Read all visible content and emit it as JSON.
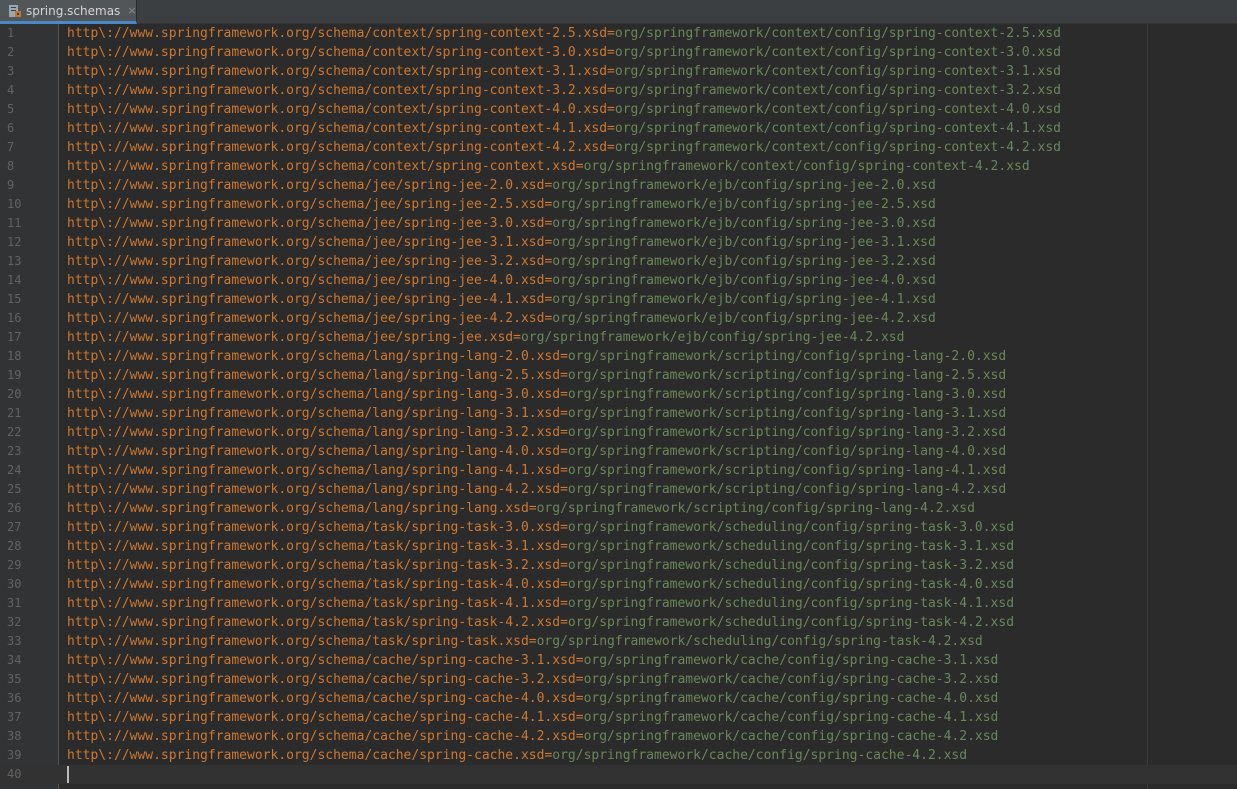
{
  "tab": {
    "label": "spring.schemas",
    "close_glyph": "×",
    "icon": "properties-file-icon"
  },
  "colors": {
    "key": "#cc7832",
    "value": "#6a8759",
    "background": "#2b2b2b",
    "gutter": "#313335",
    "line_number": "#606366"
  },
  "lines": [
    {
      "n": "1",
      "key": "http\\://www.springframework.org/schema/context/spring-context-2.5.xsd",
      "value": "org/springframework/context/config/spring-context-2.5.xsd"
    },
    {
      "n": "2",
      "key": "http\\://www.springframework.org/schema/context/spring-context-3.0.xsd",
      "value": "org/springframework/context/config/spring-context-3.0.xsd"
    },
    {
      "n": "3",
      "key": "http\\://www.springframework.org/schema/context/spring-context-3.1.xsd",
      "value": "org/springframework/context/config/spring-context-3.1.xsd"
    },
    {
      "n": "4",
      "key": "http\\://www.springframework.org/schema/context/spring-context-3.2.xsd",
      "value": "org/springframework/context/config/spring-context-3.2.xsd"
    },
    {
      "n": "5",
      "key": "http\\://www.springframework.org/schema/context/spring-context-4.0.xsd",
      "value": "org/springframework/context/config/spring-context-4.0.xsd"
    },
    {
      "n": "6",
      "key": "http\\://www.springframework.org/schema/context/spring-context-4.1.xsd",
      "value": "org/springframework/context/config/spring-context-4.1.xsd"
    },
    {
      "n": "7",
      "key": "http\\://www.springframework.org/schema/context/spring-context-4.2.xsd",
      "value": "org/springframework/context/config/spring-context-4.2.xsd"
    },
    {
      "n": "8",
      "key": "http\\://www.springframework.org/schema/context/spring-context.xsd",
      "value": "org/springframework/context/config/spring-context-4.2.xsd"
    },
    {
      "n": "9",
      "key": "http\\://www.springframework.org/schema/jee/spring-jee-2.0.xsd",
      "value": "org/springframework/ejb/config/spring-jee-2.0.xsd"
    },
    {
      "n": "10",
      "key": "http\\://www.springframework.org/schema/jee/spring-jee-2.5.xsd",
      "value": "org/springframework/ejb/config/spring-jee-2.5.xsd"
    },
    {
      "n": "11",
      "key": "http\\://www.springframework.org/schema/jee/spring-jee-3.0.xsd",
      "value": "org/springframework/ejb/config/spring-jee-3.0.xsd"
    },
    {
      "n": "12",
      "key": "http\\://www.springframework.org/schema/jee/spring-jee-3.1.xsd",
      "value": "org/springframework/ejb/config/spring-jee-3.1.xsd"
    },
    {
      "n": "13",
      "key": "http\\://www.springframework.org/schema/jee/spring-jee-3.2.xsd",
      "value": "org/springframework/ejb/config/spring-jee-3.2.xsd"
    },
    {
      "n": "14",
      "key": "http\\://www.springframework.org/schema/jee/spring-jee-4.0.xsd",
      "value": "org/springframework/ejb/config/spring-jee-4.0.xsd"
    },
    {
      "n": "15",
      "key": "http\\://www.springframework.org/schema/jee/spring-jee-4.1.xsd",
      "value": "org/springframework/ejb/config/spring-jee-4.1.xsd"
    },
    {
      "n": "16",
      "key": "http\\://www.springframework.org/schema/jee/spring-jee-4.2.xsd",
      "value": "org/springframework/ejb/config/spring-jee-4.2.xsd"
    },
    {
      "n": "17",
      "key": "http\\://www.springframework.org/schema/jee/spring-jee.xsd",
      "value": "org/springframework/ejb/config/spring-jee-4.2.xsd"
    },
    {
      "n": "18",
      "key": "http\\://www.springframework.org/schema/lang/spring-lang-2.0.xsd",
      "value": "org/springframework/scripting/config/spring-lang-2.0.xsd"
    },
    {
      "n": "19",
      "key": "http\\://www.springframework.org/schema/lang/spring-lang-2.5.xsd",
      "value": "org/springframework/scripting/config/spring-lang-2.5.xsd"
    },
    {
      "n": "20",
      "key": "http\\://www.springframework.org/schema/lang/spring-lang-3.0.xsd",
      "value": "org/springframework/scripting/config/spring-lang-3.0.xsd"
    },
    {
      "n": "21",
      "key": "http\\://www.springframework.org/schema/lang/spring-lang-3.1.xsd",
      "value": "org/springframework/scripting/config/spring-lang-3.1.xsd"
    },
    {
      "n": "22",
      "key": "http\\://www.springframework.org/schema/lang/spring-lang-3.2.xsd",
      "value": "org/springframework/scripting/config/spring-lang-3.2.xsd"
    },
    {
      "n": "23",
      "key": "http\\://www.springframework.org/schema/lang/spring-lang-4.0.xsd",
      "value": "org/springframework/scripting/config/spring-lang-4.0.xsd"
    },
    {
      "n": "24",
      "key": "http\\://www.springframework.org/schema/lang/spring-lang-4.1.xsd",
      "value": "org/springframework/scripting/config/spring-lang-4.1.xsd"
    },
    {
      "n": "25",
      "key": "http\\://www.springframework.org/schema/lang/spring-lang-4.2.xsd",
      "value": "org/springframework/scripting/config/spring-lang-4.2.xsd"
    },
    {
      "n": "26",
      "key": "http\\://www.springframework.org/schema/lang/spring-lang.xsd",
      "value": "org/springframework/scripting/config/spring-lang-4.2.xsd"
    },
    {
      "n": "27",
      "key": "http\\://www.springframework.org/schema/task/spring-task-3.0.xsd",
      "value": "org/springframework/scheduling/config/spring-task-3.0.xsd"
    },
    {
      "n": "28",
      "key": "http\\://www.springframework.org/schema/task/spring-task-3.1.xsd",
      "value": "org/springframework/scheduling/config/spring-task-3.1.xsd"
    },
    {
      "n": "29",
      "key": "http\\://www.springframework.org/schema/task/spring-task-3.2.xsd",
      "value": "org/springframework/scheduling/config/spring-task-3.2.xsd"
    },
    {
      "n": "30",
      "key": "http\\://www.springframework.org/schema/task/spring-task-4.0.xsd",
      "value": "org/springframework/scheduling/config/spring-task-4.0.xsd"
    },
    {
      "n": "31",
      "key": "http\\://www.springframework.org/schema/task/spring-task-4.1.xsd",
      "value": "org/springframework/scheduling/config/spring-task-4.1.xsd"
    },
    {
      "n": "32",
      "key": "http\\://www.springframework.org/schema/task/spring-task-4.2.xsd",
      "value": "org/springframework/scheduling/config/spring-task-4.2.xsd"
    },
    {
      "n": "33",
      "key": "http\\://www.springframework.org/schema/task/spring-task.xsd",
      "value": "org/springframework/scheduling/config/spring-task-4.2.xsd"
    },
    {
      "n": "34",
      "key": "http\\://www.springframework.org/schema/cache/spring-cache-3.1.xsd",
      "value": "org/springframework/cache/config/spring-cache-3.1.xsd"
    },
    {
      "n": "35",
      "key": "http\\://www.springframework.org/schema/cache/spring-cache-3.2.xsd",
      "value": "org/springframework/cache/config/spring-cache-3.2.xsd"
    },
    {
      "n": "36",
      "key": "http\\://www.springframework.org/schema/cache/spring-cache-4.0.xsd",
      "value": "org/springframework/cache/config/spring-cache-4.0.xsd"
    },
    {
      "n": "37",
      "key": "http\\://www.springframework.org/schema/cache/spring-cache-4.1.xsd",
      "value": "org/springframework/cache/config/spring-cache-4.1.xsd"
    },
    {
      "n": "38",
      "key": "http\\://www.springframework.org/schema/cache/spring-cache-4.2.xsd",
      "value": "org/springframework/cache/config/spring-cache-4.2.xsd"
    },
    {
      "n": "39",
      "key": "http\\://www.springframework.org/schema/cache/spring-cache.xsd",
      "value": "org/springframework/cache/config/spring-cache-4.2.xsd"
    },
    {
      "n": "40",
      "key": "",
      "value": "",
      "current": true
    }
  ]
}
